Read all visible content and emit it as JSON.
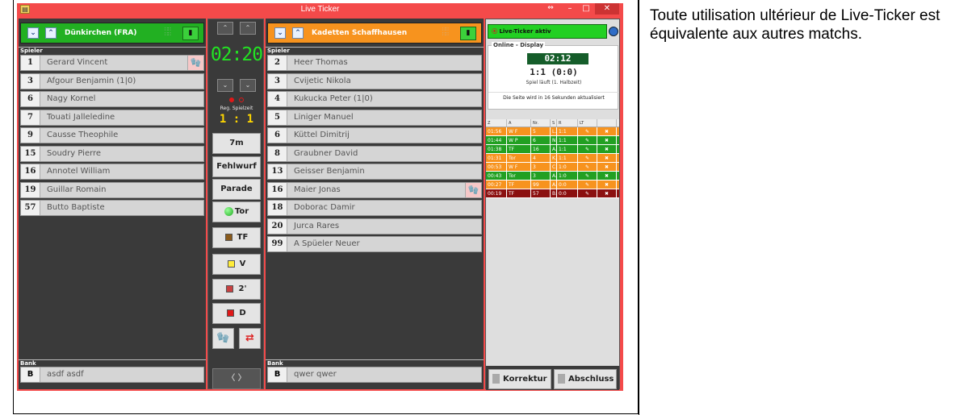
{
  "window": {
    "title": "Live Ticker",
    "app_icon": "ticker-app-icon",
    "controls": [
      "⇔",
      "–",
      "□",
      "✕"
    ]
  },
  "caption": "Toute utilisation ultérieur de Live-Ticker est équivalente aux autres matchs.",
  "home": {
    "name": "Dünkirchen (FRA)",
    "color": "#22b022",
    "players_label": "Spieler",
    "players": [
      {
        "number": "1",
        "name": "Gerard Vincent",
        "penalty_icon": "goalkeeper-icon"
      },
      {
        "number": "3",
        "name": "Afgour Benjamin (1|0)"
      },
      {
        "number": "6",
        "name": "Nagy Kornel"
      },
      {
        "number": "7",
        "name": "Touati Jalleledine"
      },
      {
        "number": "9",
        "name": "Causse Theophile"
      },
      {
        "number": "15",
        "name": "Soudry Pierre"
      },
      {
        "number": "16",
        "name": "Annotel William"
      },
      {
        "number": "19",
        "name": "Guillar Romain"
      },
      {
        "number": "57",
        "name": "Butto Baptiste"
      }
    ],
    "bank_label": "Bank",
    "bank": {
      "number": "B",
      "name": "asdf asdf"
    }
  },
  "away": {
    "name": "Kadetten Schaffhausen",
    "color": "#f7931e",
    "players_label": "Spieler",
    "players": [
      {
        "number": "2",
        "name": "Heer Thomas"
      },
      {
        "number": "3",
        "name": "Cvijetic Nikola"
      },
      {
        "number": "4",
        "name": "Kukucka Peter (1|0)"
      },
      {
        "number": "5",
        "name": "Liniger Manuel"
      },
      {
        "number": "6",
        "name": "Küttel Dimitrij"
      },
      {
        "number": "8",
        "name": "Graubner David"
      },
      {
        "number": "13",
        "name": "Geisser Benjamin"
      },
      {
        "number": "16",
        "name": "Maier Jonas",
        "penalty_icon": "goalkeeper-icon"
      },
      {
        "number": "18",
        "name": "Doborac Damir"
      },
      {
        "number": "20",
        "name": "Jurca Rares"
      },
      {
        "number": "99",
        "name": "A Spüeler Neuer"
      }
    ],
    "bank_label": "Bank",
    "bank": {
      "number": "B",
      "name": "qwer qwer"
    }
  },
  "center": {
    "clock": "02:20",
    "reg_label": "Reg. Spielzeit",
    "reg_score": "1 : 1",
    "buttons": {
      "seven_m": "7m",
      "fehlwurf": "Fehlwurf",
      "parade": "Parade",
      "tor": "Tor",
      "tf": "TF",
      "v": "V",
      "two": "2'",
      "d": "D"
    },
    "swap": "〈 〉"
  },
  "liveticker": {
    "status": "Live-Ticker aktiv",
    "display_label": "Online - Display",
    "clock": "02:12",
    "score": "1:1  (0:0)",
    "state": "Spiel läuft (1. Halbzeit)",
    "refresh": "Die Seite wird in 16 Sekunden aktualisiert",
    "columns": [
      "Z",
      "A",
      "Nr.",
      "S",
      "R",
      "LT",
      ""
    ],
    "events": [
      {
        "time": "01:56",
        "action": "W F",
        "nr": "5",
        "side": "L.",
        "result": "1:1",
        "color": "#f7931e"
      },
      {
        "time": "01:44",
        "action": "W P",
        "nr": "6",
        "side": "N.",
        "result": "1:1",
        "color": "#22a022"
      },
      {
        "time": "01:38",
        "action": "TF",
        "nr": "16",
        "side": "A.",
        "result": "1:1",
        "color": "#22a022"
      },
      {
        "time": "01:31",
        "action": "Tor",
        "nr": "4",
        "side": "K.",
        "result": "1:1",
        "color": "#f7931e"
      },
      {
        "time": "00:53",
        "action": "W F",
        "nr": "3",
        "side": "C.",
        "result": "1:0",
        "color": "#f7931e"
      },
      {
        "time": "00:43",
        "action": "Tor",
        "nr": "3",
        "side": "A.",
        "result": "1:0",
        "color": "#22a022"
      },
      {
        "time": "00:27",
        "action": "TF",
        "nr": "99",
        "side": "A.",
        "result": "0:0",
        "color": "#f7931e"
      },
      {
        "time": "00:19",
        "action": "TF",
        "nr": "57",
        "side": "B.",
        "result": "0:0",
        "color": "#8b1010"
      }
    ],
    "korrektur": "Korrektur",
    "abschluss": "Abschluss"
  }
}
